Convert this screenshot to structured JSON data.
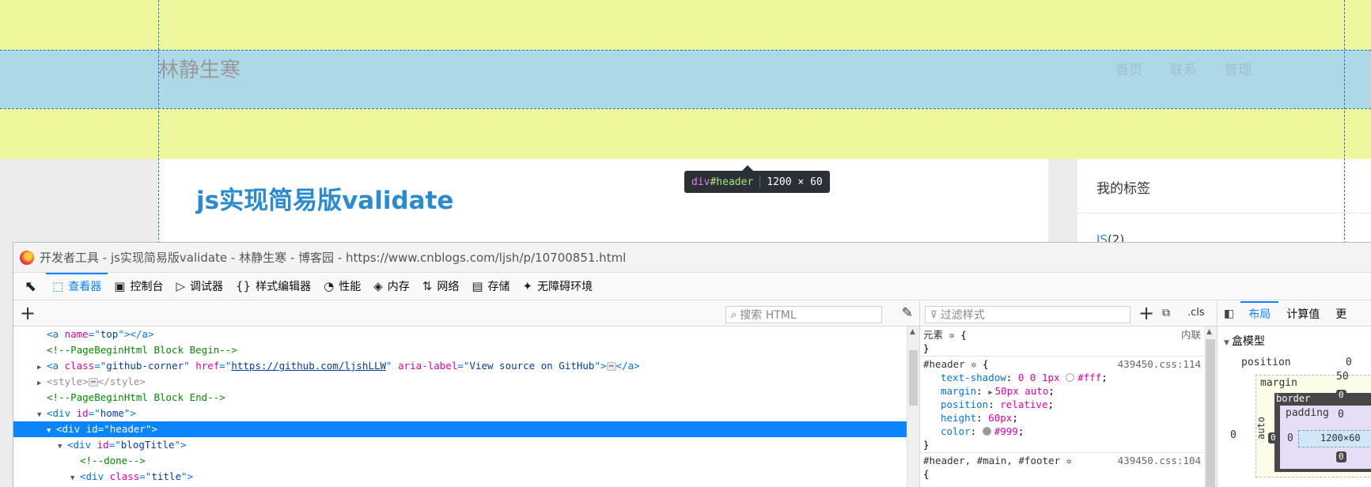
{
  "page": {
    "site_title": "林静生寒",
    "nav": [
      "首页",
      "联系",
      "管理"
    ],
    "post_title": "js实现简易版validate",
    "sidebar_title": "我的标签",
    "sidebar_tag": "JS",
    "sidebar_tag_count": "(2)"
  },
  "tooltip": {
    "tag": "div",
    "id": "#header",
    "size": "1200 × 60"
  },
  "devtools": {
    "window_title": "开发者工具 - js实现简易版validate - 林静生寒 - 博客园 - https://www.cnblogs.com/ljsh/p/10700851.html",
    "tools": [
      {
        "name": "inspector",
        "label": "查看器",
        "icon": "⬚",
        "active": true
      },
      {
        "name": "console",
        "label": "控制台",
        "icon": "▣",
        "active": false
      },
      {
        "name": "debugger",
        "label": "调试器",
        "icon": "▷",
        "active": false
      },
      {
        "name": "style-editor",
        "label": "样式编辑器",
        "icon": "{}",
        "active": false
      },
      {
        "name": "performance",
        "label": "性能",
        "icon": "◔",
        "active": false
      },
      {
        "name": "memory",
        "label": "内存",
        "icon": "◈",
        "active": false
      },
      {
        "name": "network",
        "label": "网络",
        "icon": "⇅",
        "active": false
      },
      {
        "name": "storage",
        "label": "存储",
        "icon": "▤",
        "active": false
      },
      {
        "name": "accessibility",
        "label": "无障碍环境",
        "icon": "✦",
        "active": false
      }
    ],
    "search_html_placeholder": "搜索 HTML",
    "filter_styles_placeholder": "过滤样式",
    "cls_label": ".cls",
    "layout_tabs": [
      "布局",
      "计算值",
      "更"
    ],
    "box_model_heading": "盒模型",
    "box_model": {
      "position_label": "position",
      "position_value": "0",
      "margin_label": "margin",
      "margin_top": "50",
      "margin_left": "auto",
      "outer_left": "0",
      "border_label": "border",
      "border_value": "0",
      "padding_label": "padding",
      "padding_value": "0",
      "content": "1200×60"
    },
    "rules": {
      "element_label": "元素",
      "inline_label": "内联",
      "rule1_selector": "#header",
      "rule1_source": "439450.css:114",
      "rule1_props": [
        {
          "name": "text-shadow",
          "value": "0 0 1px",
          "swatch": "#ffffff",
          "after": "#fff"
        },
        {
          "name": "margin",
          "value": "50px auto",
          "expand": true
        },
        {
          "name": "position",
          "value": "relative"
        },
        {
          "name": "height",
          "value": "60px"
        },
        {
          "name": "color",
          "value": "#999",
          "swatch_before": "#999999"
        }
      ],
      "rule2_selector": "#header, #main, #footer",
      "rule2_source": "439450.css:104"
    }
  }
}
